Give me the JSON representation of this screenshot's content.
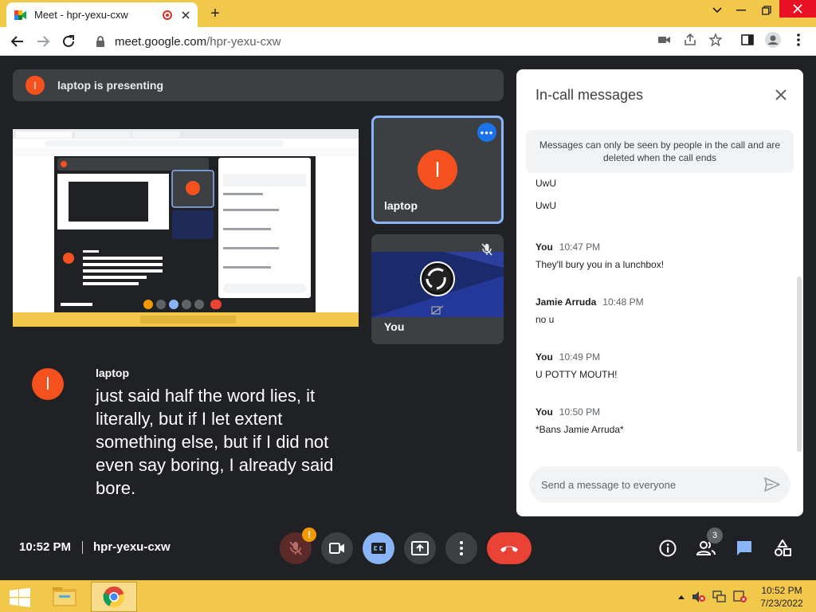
{
  "browser": {
    "tab_title": "Meet - hpr-yexu-cxw",
    "new_tab_label": "+",
    "url_host": "meet.google.com",
    "url_path": "/hpr-yexu-cxw"
  },
  "meet": {
    "presenting_banner": "laptop is presenting",
    "tiles": [
      {
        "name": "laptop",
        "initial": "l",
        "more_label": "•••"
      },
      {
        "name": "You"
      }
    ],
    "caption": {
      "speaker": "laptop",
      "initial": "l",
      "text": "just said half the word lies, it literally, but if I let extent something else, but if I did not even say boring, I already said bore."
    },
    "chat": {
      "title": "In-call messages",
      "notice": "Messages can only be seen by people in the call and are deleted when the call ends",
      "messages": [
        {
          "sender": "",
          "time": "",
          "body": "UwU"
        },
        {
          "sender": "",
          "time": "",
          "body": "UwU"
        },
        {
          "sender": "You",
          "time": "10:47 PM",
          "body": "They'll bury you in a lunchbox!"
        },
        {
          "sender": "Jamie Arruda",
          "time": "10:48 PM",
          "body": "no u"
        },
        {
          "sender": "You",
          "time": "10:49 PM",
          "body": "U POTTY MOUTH!"
        },
        {
          "sender": "You",
          "time": "10:50 PM",
          "body": "*Bans Jamie Arruda*"
        }
      ],
      "input_placeholder": "Send a message to everyone"
    },
    "controls": {
      "time": "10:52 PM",
      "meeting_code": "hpr-yexu-cxw",
      "mic_warning": "!",
      "people_count": "3"
    }
  },
  "taskbar": {
    "time": "10:52 PM",
    "date": "7/23/2022"
  },
  "colors": {
    "accent": "#1a73e8",
    "avatar": "#f4511e",
    "leave": "#ea4335",
    "cc_active": "#8ab4f8",
    "meet_bg": "#202124"
  }
}
